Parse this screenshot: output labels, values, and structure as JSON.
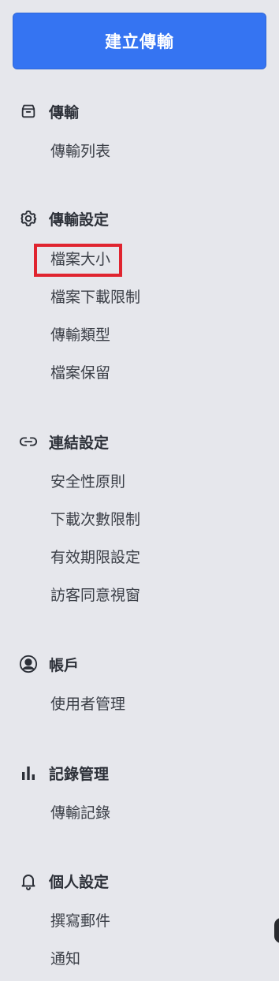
{
  "create_button": {
    "label": "建立傳輸",
    "color": "#3574F2"
  },
  "sections": {
    "transfer": {
      "title": "傳輸",
      "icon": "box-icon",
      "items": [
        "傳輸列表"
      ]
    },
    "transfer_settings": {
      "title": "傳輸設定",
      "icon": "gear-icon",
      "items": [
        "檔案大小",
        "檔案下載限制",
        "傳輸類型",
        "檔案保留"
      ]
    },
    "link_settings": {
      "title": "連結設定",
      "icon": "link-icon",
      "items": [
        "安全性原則",
        "下載次數限制",
        "有效期限設定",
        "訪客同意視窗"
      ]
    },
    "account": {
      "title": "帳戶",
      "icon": "user-circle-icon",
      "items": [
        "使用者管理"
      ]
    },
    "logs": {
      "title": "記錄管理",
      "icon": "bar-chart-icon",
      "items": [
        "傳輸記錄"
      ]
    },
    "personal_settings": {
      "title": "個人設定",
      "icon": "bell-icon",
      "items": [
        "撰寫郵件",
        "通知"
      ]
    }
  },
  "highlight": {
    "target": "檔案大小",
    "color": "#E0242F"
  }
}
